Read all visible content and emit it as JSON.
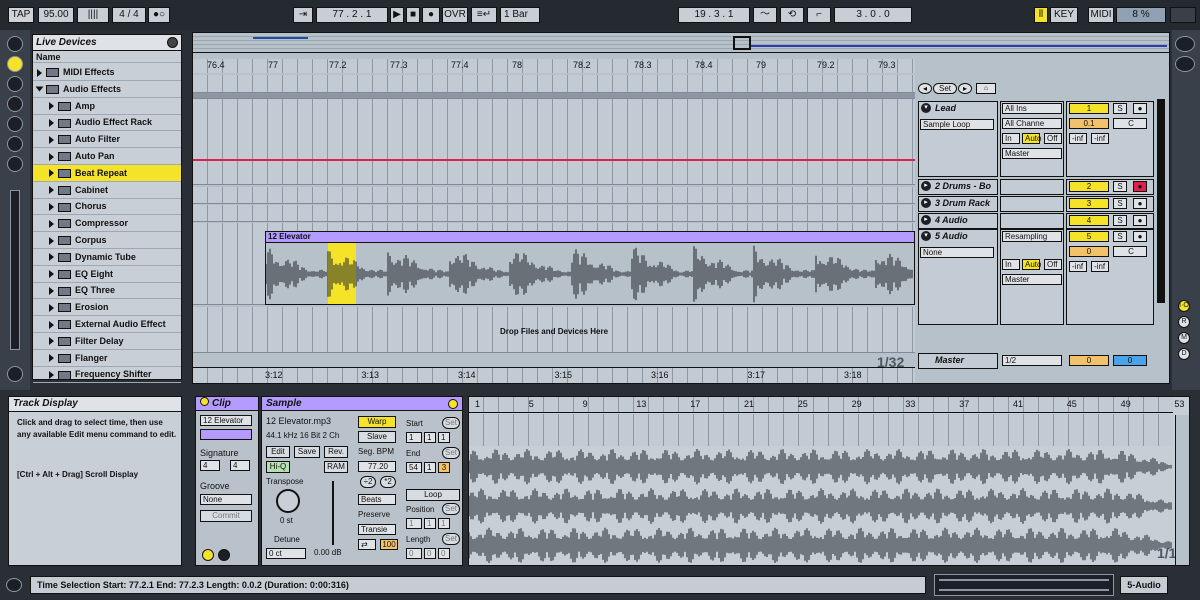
{
  "transport": {
    "tap": "TAP",
    "tempo": "95.00",
    "signature_num": "4",
    "signature_den": "4",
    "position": "77 . 2 . 1",
    "ovr": "OVR",
    "quantize": "1 Bar",
    "loop_start": "19 . 3 . 1",
    "loop_length": "3 . 0 . 0",
    "key": "KEY",
    "midi": "MIDI",
    "cpu": "8 %"
  },
  "browser": {
    "title": "Live Devices",
    "column": "Name",
    "items": [
      {
        "label": "MIDI Effects",
        "type": "folder-closed"
      },
      {
        "label": "Audio Effects",
        "type": "folder-open"
      },
      {
        "label": "Amp",
        "type": "device"
      },
      {
        "label": "Audio Effect Rack",
        "type": "device"
      },
      {
        "label": "Auto Filter",
        "type": "device"
      },
      {
        "label": "Auto Pan",
        "type": "device"
      },
      {
        "label": "Beat Repeat",
        "type": "device",
        "selected": true
      },
      {
        "label": "Cabinet",
        "type": "device"
      },
      {
        "label": "Chorus",
        "type": "device"
      },
      {
        "label": "Compressor",
        "type": "device"
      },
      {
        "label": "Corpus",
        "type": "device"
      },
      {
        "label": "Dynamic Tube",
        "type": "device"
      },
      {
        "label": "EQ Eight",
        "type": "device"
      },
      {
        "label": "EQ Three",
        "type": "device"
      },
      {
        "label": "Erosion",
        "type": "device"
      },
      {
        "label": "External Audio Effect",
        "type": "device"
      },
      {
        "label": "Filter Delay",
        "type": "device"
      },
      {
        "label": "Flanger",
        "type": "device"
      },
      {
        "label": "Frequency Shifter",
        "type": "device"
      }
    ]
  },
  "arrangement": {
    "beat_ruler": [
      "76.4",
      "77",
      "77.2",
      "77.3",
      "77.4",
      "78",
      "78.2",
      "78.3",
      "78.4",
      "79",
      "79.2",
      "79.3"
    ],
    "time_ruler": [
      "3:12",
      "3:13",
      "3:14",
      "3:15",
      "3:16",
      "3:17",
      "3:18"
    ],
    "clip_name": "12 Elevator",
    "drop_text": "Drop Files and Devices Here",
    "zoom": "1/32",
    "set_label": "Set"
  },
  "tracks": [
    {
      "name": "Lead",
      "input": "All Ins",
      "channel": "All Channe",
      "clip": "Sample Loop",
      "number": "1",
      "volume": "0.1",
      "pan": "C",
      "send1": "-inf",
      "send2": "-inf",
      "output": "Master",
      "in": "In",
      "auto": "Auto",
      "off": "Off"
    },
    {
      "name": "2 Drums - Bo",
      "number": "2"
    },
    {
      "name": "3 Drum Rack",
      "number": "3"
    },
    {
      "name": "4 Audio",
      "number": "4"
    },
    {
      "name": "5 Audio",
      "input": "Resampling",
      "clip": "None",
      "number": "5",
      "volume": "0",
      "pan": "C",
      "send1": "-inf",
      "send2": "-inf",
      "output": "Master",
      "in": "In",
      "auto": "Auto",
      "off": "Off"
    }
  ],
  "master": {
    "name": "Master",
    "output": "1/2",
    "volume": "0",
    "pan": "0"
  },
  "info_view": {
    "title": "Track Display",
    "text1": "Click and drag to select time, then use any available Edit menu command to edit.",
    "text2": "[Ctrl + Alt + Drag] Scroll Display"
  },
  "clip_view": {
    "title": "Clip",
    "name": "12 Elevator",
    "signature_label": "Signature",
    "sig_num": "4",
    "sig_den": "4",
    "groove_label": "Groove",
    "groove": "None",
    "commit": "Commit"
  },
  "sample_view": {
    "title": "Sample",
    "file": "12 Elevator.mp3",
    "format": "44.1 kHz 16 Bit 2 Ch",
    "edit": "Edit",
    "save": "Save",
    "rev": "Rev.",
    "hiq": "Hi-Q",
    "ram": "RAM",
    "warp": "Warp",
    "slave": "Slave",
    "seg_bpm_label": "Seg. BPM",
    "seg_bpm": "77.20",
    "half": "÷2",
    "double": "*2",
    "transpose_label": "Transpose",
    "transpose": "0 st",
    "detune_label": "Detune",
    "detune": "0 ct",
    "gain": "0.00 dB",
    "warp_mode": "Beats",
    "preserve_label": "Preserve",
    "preserve": "Transie",
    "loop_mode_value": "100",
    "start_label": "Start",
    "start": [
      "1",
      "1",
      "1"
    ],
    "end_label": "End",
    "end": [
      "54",
      "1",
      "3"
    ],
    "loop": "Loop",
    "position_label": "Position",
    "position": [
      "1",
      "1",
      "1"
    ],
    "length_label": "Length",
    "length": [
      "0",
      "0",
      "0"
    ],
    "set": "Set"
  },
  "sample_ruler": [
    "1",
    "5",
    "9",
    "13",
    "17",
    "21",
    "25",
    "29",
    "33",
    "37",
    "41",
    "45",
    "49",
    "53"
  ],
  "sample_zoom": "1/1",
  "status_bar": {
    "text": "Time Selection    Start: 77.2.1    End: 77.2.3    Length: 0.0.2  (Duration: 0:00:316)",
    "track": "5-Audio"
  },
  "colors": {
    "accent_yellow": "#f5e32a",
    "clip_purple": "#b39bff",
    "automation_red": "#e0204a",
    "panel": "#b9c2cb"
  }
}
